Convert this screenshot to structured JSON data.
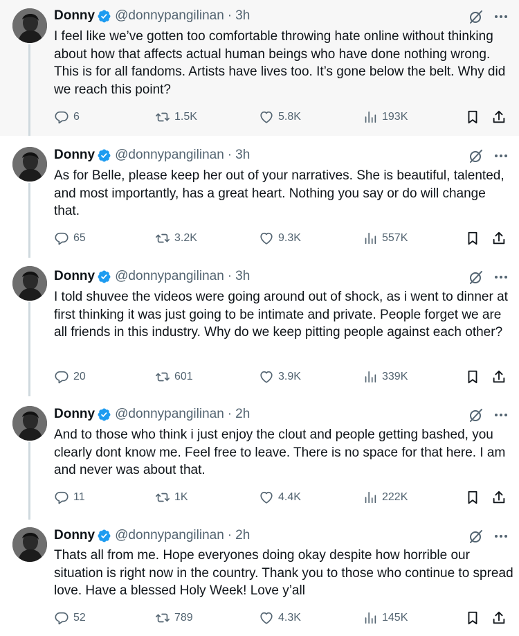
{
  "author": {
    "name": "Donny",
    "handle": "@donnypangilinan",
    "verified_color": "#1d9bf0"
  },
  "icons": {
    "reply": "reply-icon",
    "retweet": "retweet-icon",
    "like": "heart-icon",
    "views": "views-chart-icon",
    "bookmark": "bookmark-icon",
    "share": "share-icon",
    "grok": "grok-icon",
    "more": "more-icon"
  },
  "tweets": [
    {
      "time": "3h",
      "text": "I feel like we’ve gotten too comfortable throwing hate online without thinking about how that affects actual human beings who have done nothing wrong. This is for all fandoms. Artists have lives too. It’s gone below the belt. Why did we reach this point?",
      "replies": "6",
      "retweets": "1.5K",
      "likes": "5.8K",
      "views": "193K"
    },
    {
      "time": "3h",
      "text": "As for Belle, please keep her out of your narratives. She is beautiful, talented, and most importantly, has a great heart. Nothing you say or do will change that.",
      "replies": "65",
      "retweets": "3.2K",
      "likes": "9.3K",
      "views": "557K"
    },
    {
      "time": "3h",
      "text": "I told shuvee the videos were going around out of shock, as i went to dinner at first thinking it was just going to be intimate and private. People forget we are all friends in this industry. Why do we keep pitting people against each other?",
      "replies": "20",
      "retweets": "601",
      "likes": "3.9K",
      "views": "339K"
    },
    {
      "time": "2h",
      "text": "And to those who think i just enjoy the clout and people getting bashed, you clearly dont know me. Feel free to leave. There is no space for that here. I am and never was about that.",
      "replies": "11",
      "retweets": "1K",
      "likes": "4.4K",
      "views": "222K"
    },
    {
      "time": "2h",
      "text": "Thats all from me. Hope everyones doing okay despite how horrible our situation is right now in the country. Thank you to those who continue to spread love. Have a blessed Holy Week! Love y’all",
      "replies": "52",
      "retweets": "789",
      "likes": "4.3K",
      "views": "145K"
    }
  ]
}
